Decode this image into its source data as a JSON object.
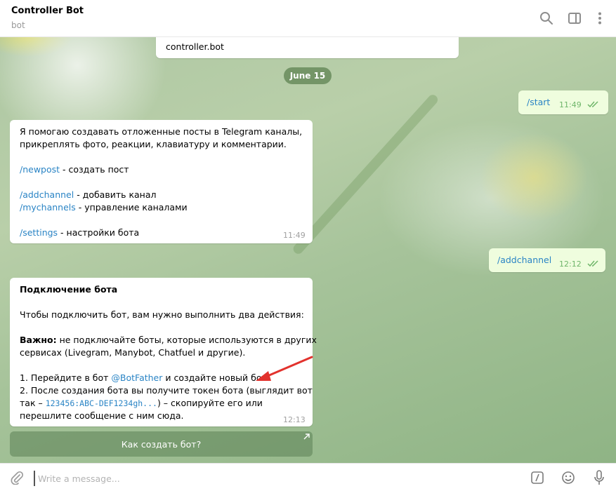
{
  "header": {
    "title": "Controller Bot",
    "subtitle": "bot"
  },
  "chat": {
    "top_bubble_text": "controller.bot",
    "date": "June 15",
    "msg_start": {
      "text": "/start",
      "time": "11:49"
    },
    "msg_addchannel": {
      "text": "/addchannel",
      "time": "12:12"
    },
    "msg_help": {
      "line1": "Я помогаю создавать отложенные посты в Telegram каналы,",
      "line2": "прикреплять фото, реакции, клавиатуру и комментарии.",
      "newpost_cmd": "/newpost",
      "newpost_desc": " - создать пост",
      "addchannel_cmd": "/addchannel",
      "addchannel_desc": " - добавить канал",
      "mychannels_cmd": "/mychannels",
      "mychannels_desc": " - управление каналами",
      "settings_cmd": "/settings",
      "settings_desc": " - настройки бота",
      "time": "11:49"
    },
    "msg_connect": {
      "title": "Подключение бота",
      "intro": "Чтобы подключить бот, вам нужно выполнить два действия:",
      "important_label": "Важно:",
      "important_text": " не подключайте боты, которые используются в других",
      "important_text2": "сервисах (Livegram, Manybot, Chatfuel и другие).",
      "step1_pre": "1. Перейдите в бот ",
      "step1_link": "@BotFather",
      "step1_post": " и создайте новый бот.",
      "step2_line1": "2. После создания бота вы получите токен бота (выглядит вот",
      "step2_pre": "так – ",
      "step2_token": "123456:ABC-DEF1234gh...",
      "step2_post": ") – скопируйте его или",
      "step2_line3": "перешлите сообщение с ним сюда.",
      "time": "12:13"
    },
    "inline_button": "Как создать бот?"
  },
  "input": {
    "placeholder": "Write a message..."
  },
  "colors": {
    "link": "#2a84c5",
    "outgoing_bubble": "#effdde",
    "check": "#6fb66a",
    "arrow": "#e2322d"
  },
  "icons": {
    "header": [
      "search-icon",
      "sidebar-toggle-icon",
      "more-vertical-icon"
    ],
    "input": [
      "paperclip-icon",
      "command-icon",
      "emoji-icon",
      "microphone-icon"
    ]
  }
}
